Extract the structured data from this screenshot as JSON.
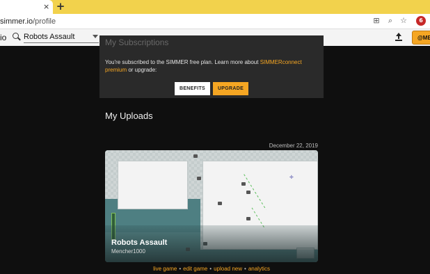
{
  "browser": {
    "tab_close": "×",
    "new_tab": "+",
    "url_prefix": "simmer.io",
    "url_path": "/profile",
    "profile_badge": "6"
  },
  "header": {
    "logo_fragment": "io",
    "search_value": "Robots Assault",
    "user_button": "@ME"
  },
  "subscription": {
    "heading": "My Subscriptions",
    "text_before": "You're subscribed to the SIMMER free plan. Learn more about ",
    "link_text": "SIMMERconnect premium",
    "text_after": " or upgrade:",
    "benefits_label": "BENEFITS",
    "upgrade_label": "UPGRADE"
  },
  "uploads": {
    "title": "My Uploads",
    "items": [
      {
        "date": "December 22, 2019",
        "game_title": "Robots Assault",
        "author": "Mencher1000",
        "links": [
          "live game",
          "edit game",
          "upload new",
          "analytics"
        ]
      }
    ]
  },
  "colors": {
    "accent": "#f5a623",
    "page_bg": "#0f0f0f",
    "panel_bg": "#2a2a2a",
    "tab_strip": "#f2d24c"
  },
  "icons": [
    "close-icon",
    "plus-icon",
    "lock-icon",
    "translate-icon",
    "zoom-icon",
    "star-icon",
    "search-icon",
    "chevron-down-icon",
    "upload-icon"
  ]
}
